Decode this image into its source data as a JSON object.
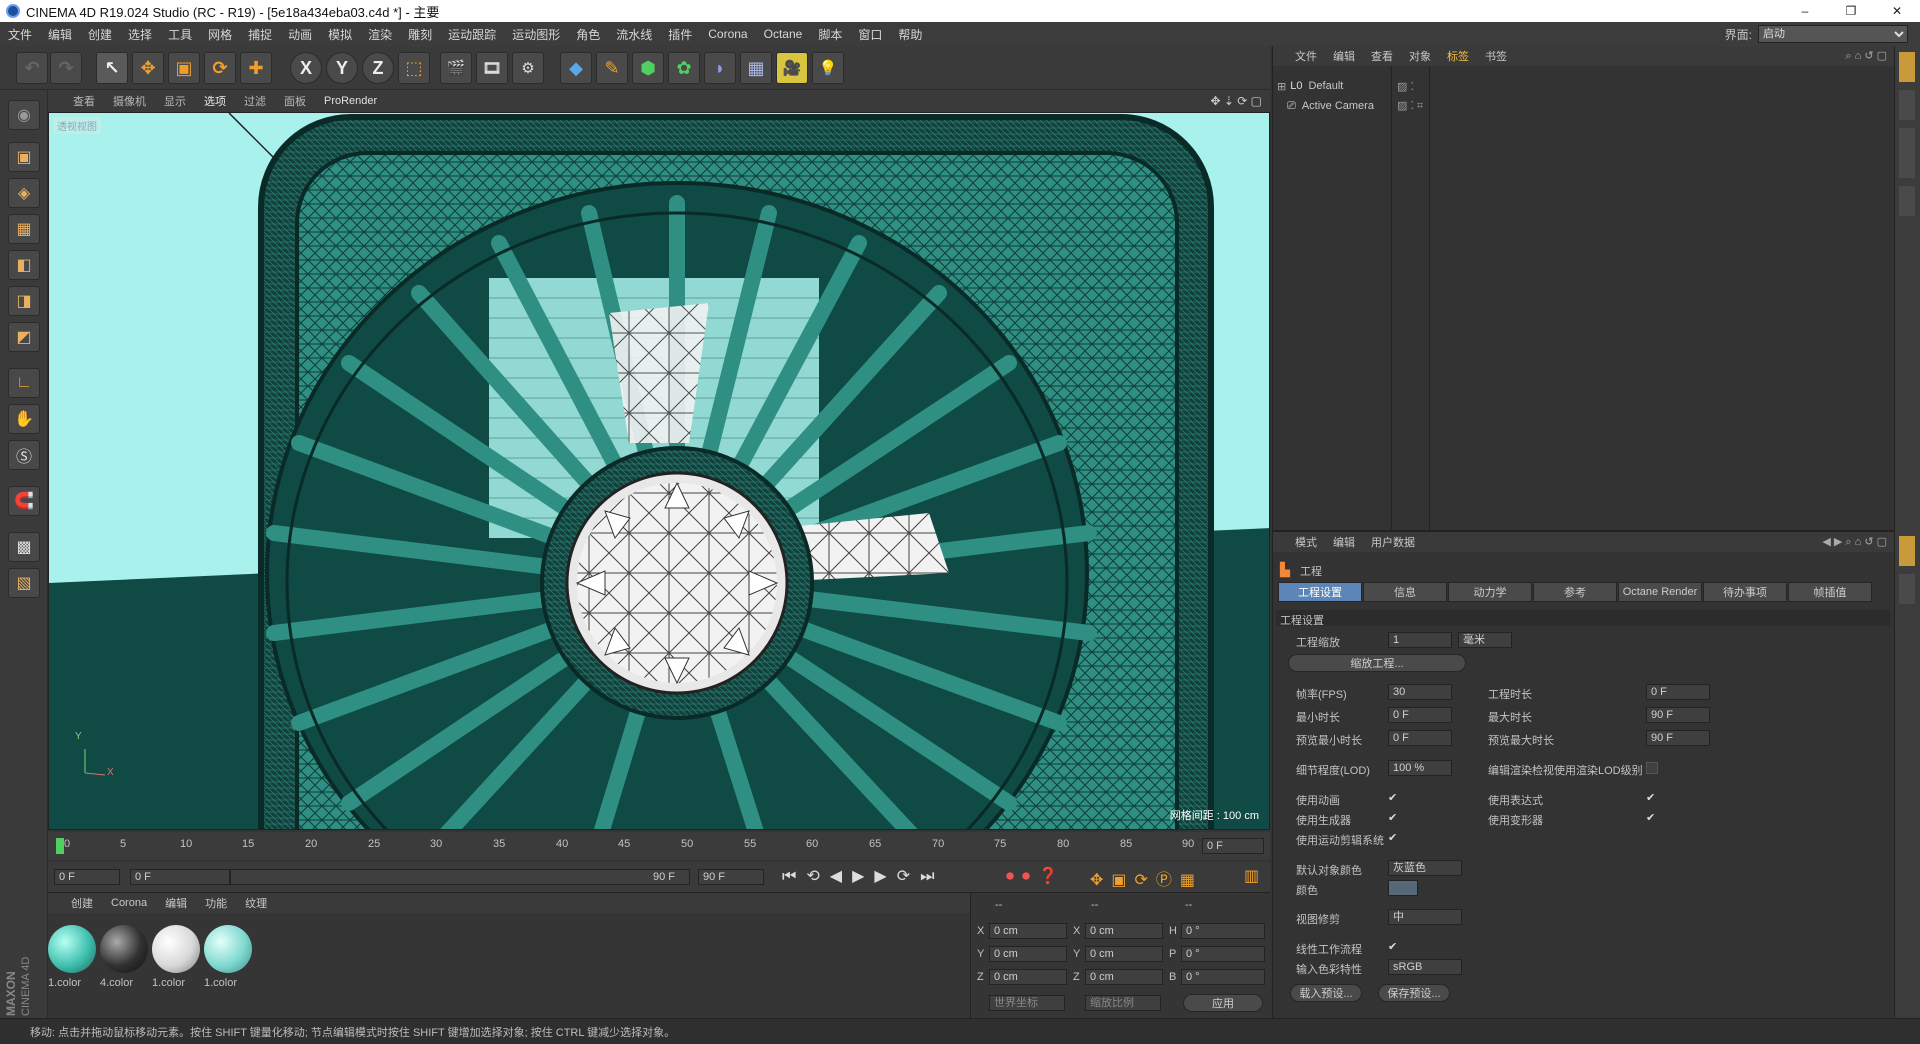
{
  "window": {
    "title": "CINEMA 4D R19.024 Studio (RC - R19) - [5e18a434eba03.c4d *] - 主要",
    "minimize": "–",
    "maximize": "❐",
    "close": "✕"
  },
  "menu": {
    "items": [
      "文件",
      "编辑",
      "创建",
      "选择",
      "工具",
      "网格",
      "捕捉",
      "动画",
      "模拟",
      "渲染",
      "雕刻",
      "运动跟踪",
      "运动图形",
      "角色",
      "流水线",
      "插件",
      "Corona",
      "Octane",
      "脚本",
      "窗口",
      "帮助"
    ],
    "interface_label": "界面:",
    "interface_value": "启动"
  },
  "toolbar": {
    "undo": "↶",
    "redo": "↷",
    "select": "↖",
    "move": "✥",
    "scale": "▣",
    "rotate": "⟳",
    "add": "✚",
    "axis_x": "X",
    "axis_y": "Y",
    "axis_z": "Z",
    "coord": "⬚",
    "render_view": "🎬",
    "render_pic": "🎞",
    "render_settings": "⚙",
    "cube": "◆",
    "pen": "✎",
    "subdiv": "⬢",
    "cloner": "✿",
    "deformer": "◗",
    "floor": "▦",
    "camera": "🎥",
    "light": "💡"
  },
  "lefttools": [
    "◉",
    "▣",
    "◈",
    "▦",
    "◧",
    "◨",
    "◩",
    "∟",
    "✋",
    "Ⓢ",
    "🧲",
    "▩",
    "▧"
  ],
  "viewport": {
    "menu": [
      "查看",
      "摄像机",
      "显示",
      "选项",
      "过滤",
      "面板",
      "ProRender"
    ],
    "corner_label": "透视视图",
    "grid_spacing": "网格间距 : 100 cm",
    "axis_y": "Y",
    "axis_x": "X"
  },
  "timeline": {
    "ticks": [
      "0",
      "5",
      "10",
      "15",
      "20",
      "25",
      "30",
      "35",
      "40",
      "45",
      "50",
      "55",
      "60",
      "65",
      "70",
      "75",
      "80",
      "85",
      "90"
    ],
    "current_frame": "0 F",
    "start": "0 F",
    "slider_start": "0 F",
    "slider_end": "90 F",
    "end": "90 F"
  },
  "materials": {
    "menu": [
      "创建",
      "Corona",
      "编辑",
      "功能",
      "纹理"
    ],
    "items": [
      {
        "label": "1.color",
        "color": "#3fbfae"
      },
      {
        "label": "4.color",
        "color": "#303030"
      },
      {
        "label": "1.color",
        "color": "#d8d8d8"
      },
      {
        "label": "1.color",
        "color": "#7fd8cf"
      }
    ],
    "brand_line1": "MAXON",
    "brand_line2": "CINEMA 4D"
  },
  "coords": {
    "headers": [
      "--",
      "--",
      "--"
    ],
    "rows": [
      {
        "a": "X",
        "av": "0 cm",
        "b": "X",
        "bv": "0 cm",
        "c": "H",
        "cv": "0 °"
      },
      {
        "a": "Y",
        "av": "0 cm",
        "b": "Y",
        "bv": "0 cm",
        "c": "P",
        "cv": "0 °"
      },
      {
        "a": "Z",
        "av": "0 cm",
        "b": "Z",
        "bv": "0 cm",
        "c": "B",
        "cv": "0 °"
      }
    ],
    "world": "世界坐标",
    "scale": "缩放比例",
    "apply": "应用"
  },
  "objects": {
    "menu": [
      "文件",
      "编辑",
      "查看",
      "对象",
      "标签",
      "书签"
    ],
    "items": [
      "Default",
      "Active Camera"
    ]
  },
  "attributes": {
    "menu": [
      "模式",
      "编辑",
      "用户数据"
    ],
    "section": "工程",
    "tabs": [
      "工程设置",
      "信息",
      "动力学",
      "参考",
      "Octane Render",
      "待办事项",
      "帧插值"
    ],
    "group": "工程设置",
    "project_scale_label": "工程缩放",
    "project_scale_value": "1",
    "project_scale_unit": "毫米",
    "scale_project_btn": "缩放工程...",
    "fps_label": "帧率(FPS)",
    "fps_value": "30",
    "proj_len_label": "工程时长",
    "proj_len_value": "0 F",
    "min_len_label": "最小时长",
    "min_len_value": "0 F",
    "max_len_label": "最大时长",
    "max_len_value": "90 F",
    "prev_min_label": "预览最小时长",
    "prev_min_value": "0 F",
    "prev_max_label": "预览最大时长",
    "prev_max_value": "90 F",
    "lod_label": "细节程度(LOD)",
    "lod_value": "100 %",
    "lod_check_label": "编辑渲染检视使用渲染LOD级别",
    "use_anim": "使用动画",
    "use_expr": "使用表达式",
    "use_gen": "使用生成器",
    "use_deform": "使用变形器",
    "use_motion": "使用运动剪辑系统",
    "def_obj_color_label": "默认对象颜色",
    "def_obj_color_value": "灰蓝色",
    "color_label": "颜色",
    "view_clip_label": "视图修剪",
    "view_clip_value": "中",
    "linear_label": "线性工作流程",
    "input_color_label": "输入色彩特性",
    "input_color_value": "sRGB",
    "load_preset": "载入预设...",
    "save_preset": "保存预设..."
  },
  "status": "移动: 点击并拖动鼠标移动元素。按住 SHIFT 键量化移动; 节点编辑模式时按住 SHIFT 键增加选择对象; 按住 CTRL 键减少选择对象。"
}
